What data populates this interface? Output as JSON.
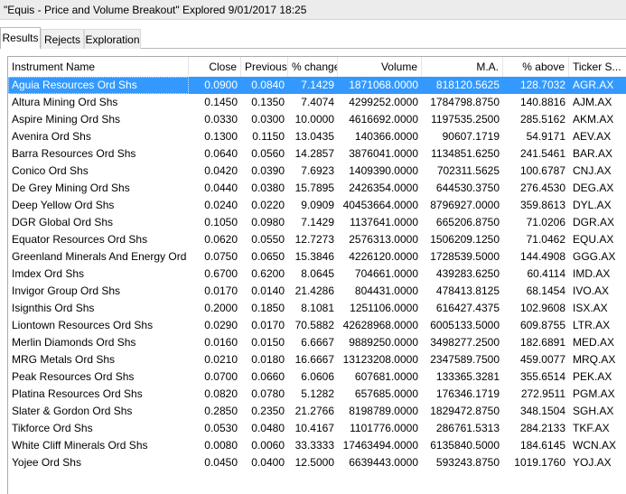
{
  "window": {
    "title": "\"Equis - Price and Volume Breakout\" Explored 9/01/2017 18:25"
  },
  "tabs": [
    {
      "label": "Results",
      "active": true
    },
    {
      "label": "Rejects",
      "active": false
    },
    {
      "label": "Exploration",
      "active": false
    }
  ],
  "columns": [
    "Instrument Name",
    "Close",
    "Previous",
    "% change",
    "Volume",
    "M.A.",
    "% above",
    "Ticker S..."
  ],
  "selected_row": 0,
  "rows": [
    [
      "Aguia Resources Ord Shs",
      "0.0900",
      "0.0840",
      "7.1429",
      "1871068.0000",
      "818120.5625",
      "128.7032",
      "AGR.AX"
    ],
    [
      "Altura Mining Ord Shs",
      "0.1450",
      "0.1350",
      "7.4074",
      "4299252.0000",
      "1784798.8750",
      "140.8816",
      "AJM.AX"
    ],
    [
      "Aspire Mining Ord Shs",
      "0.0330",
      "0.0300",
      "10.0000",
      "4616692.0000",
      "1197535.2500",
      "285.5162",
      "AKM.AX"
    ],
    [
      "Avenira Ord Shs",
      "0.1300",
      "0.1150",
      "13.0435",
      "140366.0000",
      "90607.1719",
      "54.9171",
      "AEV.AX"
    ],
    [
      "Barra Resources Ord Shs",
      "0.0640",
      "0.0560",
      "14.2857",
      "3876041.0000",
      "1134851.6250",
      "241.5461",
      "BAR.AX"
    ],
    [
      "Conico Ord Shs",
      "0.0420",
      "0.0390",
      "7.6923",
      "1409390.0000",
      "702311.5625",
      "100.6787",
      "CNJ.AX"
    ],
    [
      "De Grey Mining Ord Shs",
      "0.0440",
      "0.0380",
      "15.7895",
      "2426354.0000",
      "644530.3750",
      "276.4530",
      "DEG.AX"
    ],
    [
      "Deep Yellow Ord Shs",
      "0.0240",
      "0.0220",
      "9.0909",
      "40453664.0000",
      "8796927.0000",
      "359.8613",
      "DYL.AX"
    ],
    [
      "DGR Global Ord Shs",
      "0.1050",
      "0.0980",
      "7.1429",
      "1137641.0000",
      "665206.8750",
      "71.0206",
      "DGR.AX"
    ],
    [
      "Equator Resources Ord Shs",
      "0.0620",
      "0.0550",
      "12.7273",
      "2576313.0000",
      "1506209.1250",
      "71.0462",
      "EQU.AX"
    ],
    [
      "Greenland Minerals And Energy Ord Shs",
      "0.0750",
      "0.0650",
      "15.3846",
      "4226120.0000",
      "1728539.5000",
      "144.4908",
      "GGG.AX"
    ],
    [
      "Imdex Ord Shs",
      "0.6700",
      "0.6200",
      "8.0645",
      "704661.0000",
      "439283.6250",
      "60.4114",
      "IMD.AX"
    ],
    [
      "Invigor Group Ord Shs",
      "0.0170",
      "0.0140",
      "21.4286",
      "804431.0000",
      "478413.8125",
      "68.1454",
      "IVO.AX"
    ],
    [
      "Isignthis Ord Shs",
      "0.2000",
      "0.1850",
      "8.1081",
      "1251106.0000",
      "616427.4375",
      "102.9608",
      "ISX.AX"
    ],
    [
      "Liontown Resources Ord Shs",
      "0.0290",
      "0.0170",
      "70.5882",
      "42628968.0000",
      "6005133.5000",
      "609.8755",
      "LTR.AX"
    ],
    [
      "Merlin Diamonds Ord Shs",
      "0.0160",
      "0.0150",
      "6.6667",
      "9889250.0000",
      "3498277.2500",
      "182.6891",
      "MED.AX"
    ],
    [
      "MRG Metals Ord Shs",
      "0.0210",
      "0.0180",
      "16.6667",
      "13123208.0000",
      "2347589.7500",
      "459.0077",
      "MRQ.AX"
    ],
    [
      "Peak Resources Ord Shs",
      "0.0700",
      "0.0660",
      "6.0606",
      "607681.0000",
      "133365.3281",
      "355.6514",
      "PEK.AX"
    ],
    [
      "Platina Resources Ord Shs",
      "0.0820",
      "0.0780",
      "5.1282",
      "657685.0000",
      "176346.1719",
      "272.9511",
      "PGM.AX"
    ],
    [
      "Slater & Gordon Ord Shs",
      "0.2850",
      "0.2350",
      "21.2766",
      "8198789.0000",
      "1829472.8750",
      "348.1504",
      "SGH.AX"
    ],
    [
      "Tikforce Ord Shs",
      "0.0530",
      "0.0480",
      "10.4167",
      "1101776.0000",
      "286761.5313",
      "284.2133",
      "TKF.AX"
    ],
    [
      "White Cliff Minerals Ord Shs",
      "0.0080",
      "0.0060",
      "33.3333",
      "17463494.0000",
      "6135840.5000",
      "184.6145",
      "WCN.AX"
    ],
    [
      "Yojee Ord Shs",
      "0.0450",
      "0.0400",
      "12.5000",
      "6639443.0000",
      "593243.8750",
      "1019.1760",
      "YOJ.AX"
    ]
  ]
}
